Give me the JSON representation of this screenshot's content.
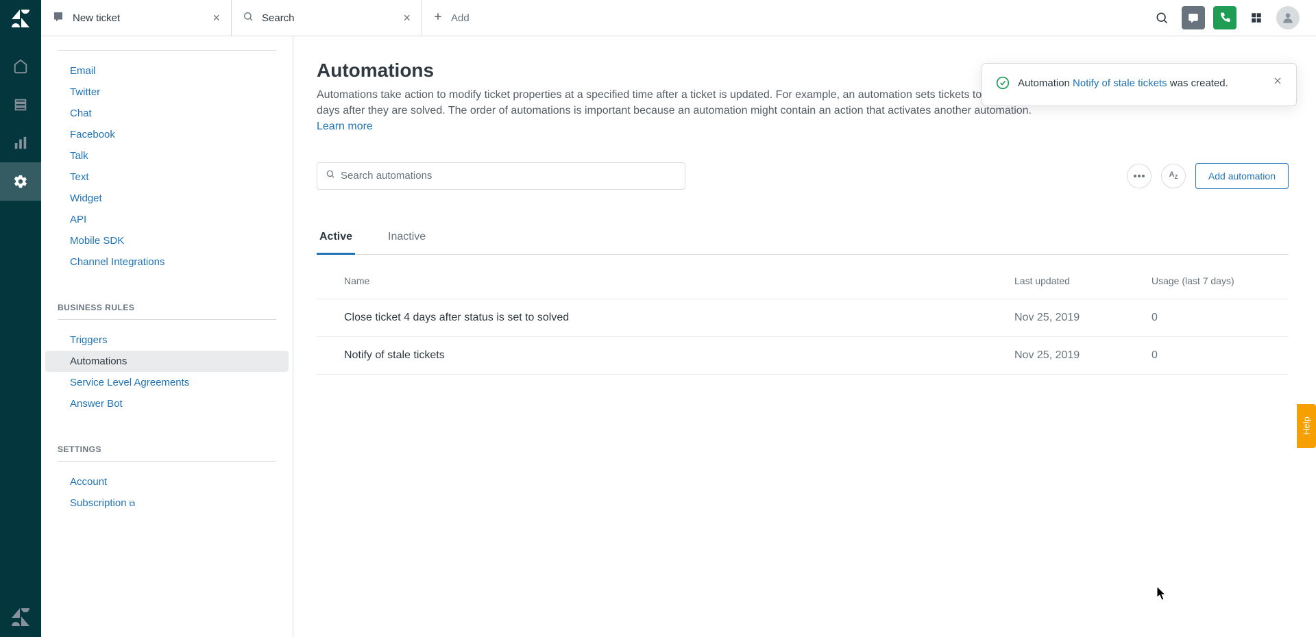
{
  "tabs": {
    "new_ticket": "New ticket",
    "search": "Search",
    "add": "Add"
  },
  "sidebar": {
    "channels": {
      "items": [
        "Email",
        "Twitter",
        "Chat",
        "Facebook",
        "Talk",
        "Text",
        "Widget",
        "API",
        "Mobile SDK",
        "Channel Integrations"
      ]
    },
    "business_rules": {
      "title": "BUSINESS RULES",
      "items": [
        "Triggers",
        "Automations",
        "Service Level Agreements",
        "Answer Bot"
      ],
      "active_index": 1
    },
    "settings": {
      "title": "SETTINGS",
      "items": [
        "Account",
        "Subscription"
      ]
    }
  },
  "main": {
    "title": "Automations",
    "desc": "Automations take action to modify ticket properties at a specified time after a ticket is updated. For example, an automation sets tickets to Closed four days after they are solved. The order of automations is important because an automation might contain an action that activates another automation. ",
    "learn_more": "Learn more",
    "search_placeholder": "Search automations",
    "add_button": "Add automation",
    "tabs": {
      "active": "Active",
      "inactive": "Inactive"
    },
    "columns": {
      "name": "Name",
      "last_updated": "Last updated",
      "usage": "Usage (last 7 days)"
    },
    "rows": [
      {
        "name": "Close ticket 4 days after status is set to solved",
        "date": "Nov 25, 2019",
        "usage": "0"
      },
      {
        "name": "Notify of stale tickets",
        "date": "Nov 25, 2019",
        "usage": "0"
      }
    ]
  },
  "toast": {
    "prefix": "Automation ",
    "link": "Notify of stale tickets",
    "suffix": " was created."
  },
  "help": "Help"
}
